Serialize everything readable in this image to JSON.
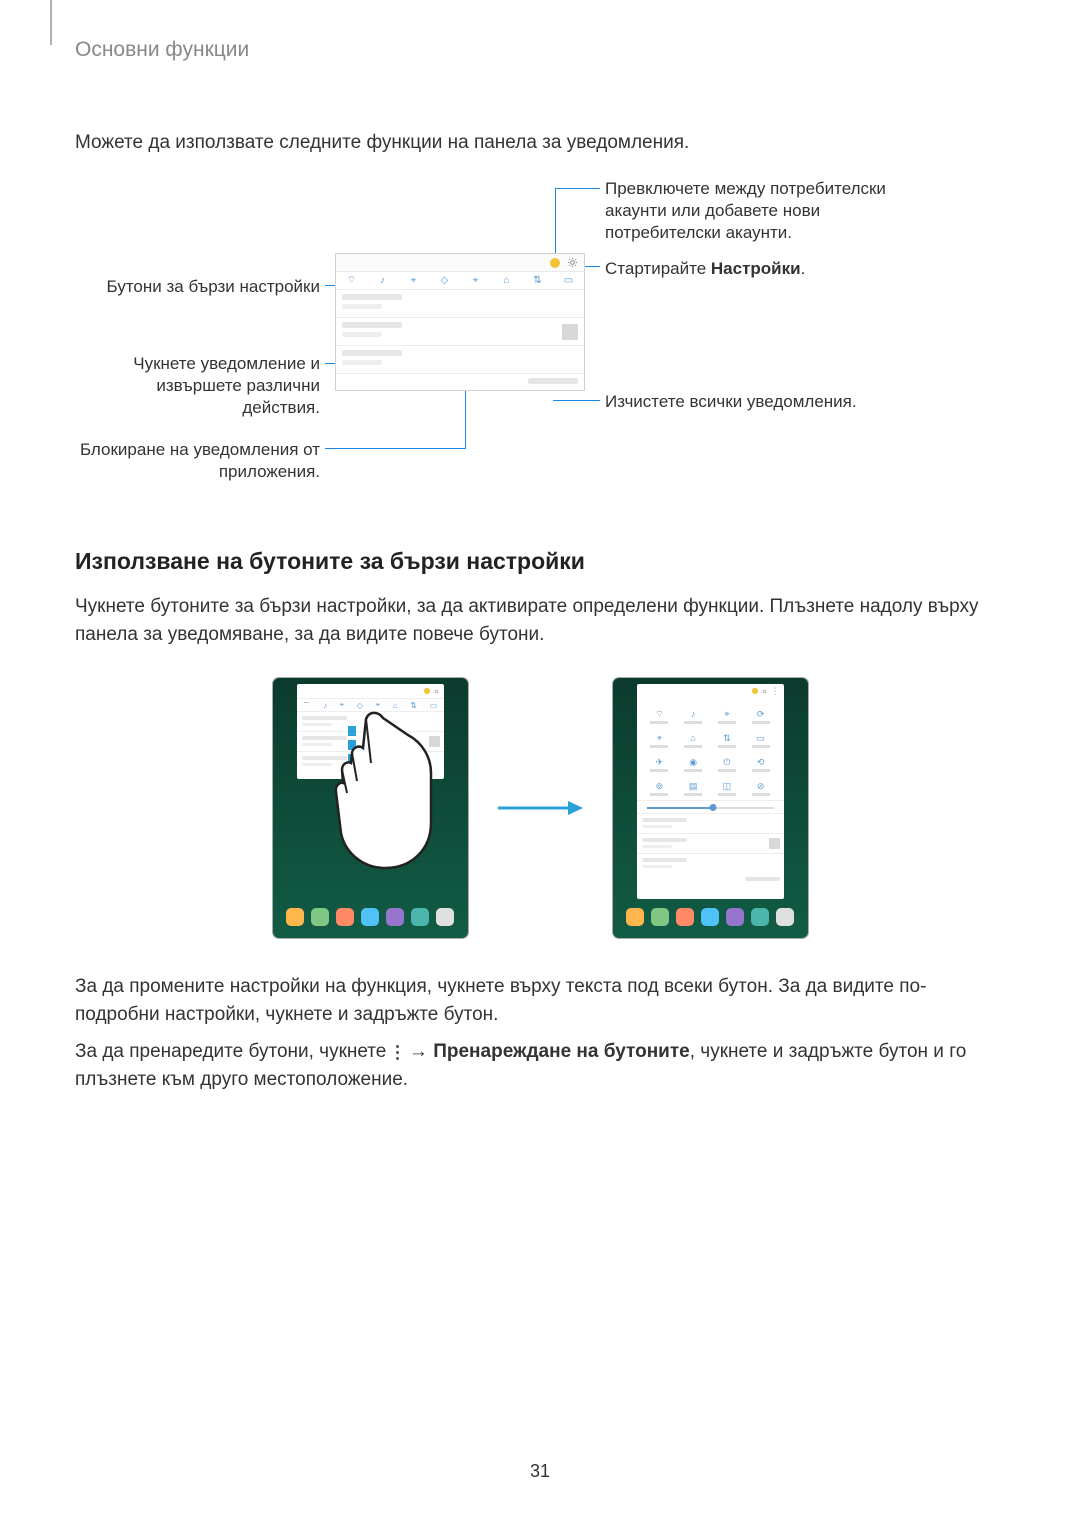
{
  "header": {
    "title": "Основни функции"
  },
  "intro": "Можете да използвате следните функции на панела за уведомления.",
  "callouts": {
    "left1": "Бутони за бързи настройки",
    "left2": "Чукнете уведомление и извършете различни действия.",
    "left3": "Блокиране на уведомления от приложения.",
    "right1": "Превключете между потребителски акаунти или добавете нови потребителски акаунти.",
    "right2_pre": "Стартирайте ",
    "right2_bold": "Настройки",
    "right2_post": ".",
    "right3": "Изчистете всички уведомления."
  },
  "section_heading": "Използване на бутоните за бързи настройки",
  "section_para": "Чукнете бутоните за бързи настройки, за да активирате определени функции. Плъзнете надолу върху панела за уведомяване, за да видите повече бутони.",
  "para_after1": "За да промените настройки на функция, чукнете върху текста под всеки бутон. За да видите по-подробни настройки, чукнете и задръжте бутон.",
  "para_after2_pre": "За да пренаредите бутони, чукнете ",
  "para_after2_arrow": " → ",
  "para_after2_bold": "Пренареждане на бутоните",
  "para_after2_post": ", чукнете и задръжте бутон и го плъзнете към друго местоположение.",
  "page_number": "31"
}
